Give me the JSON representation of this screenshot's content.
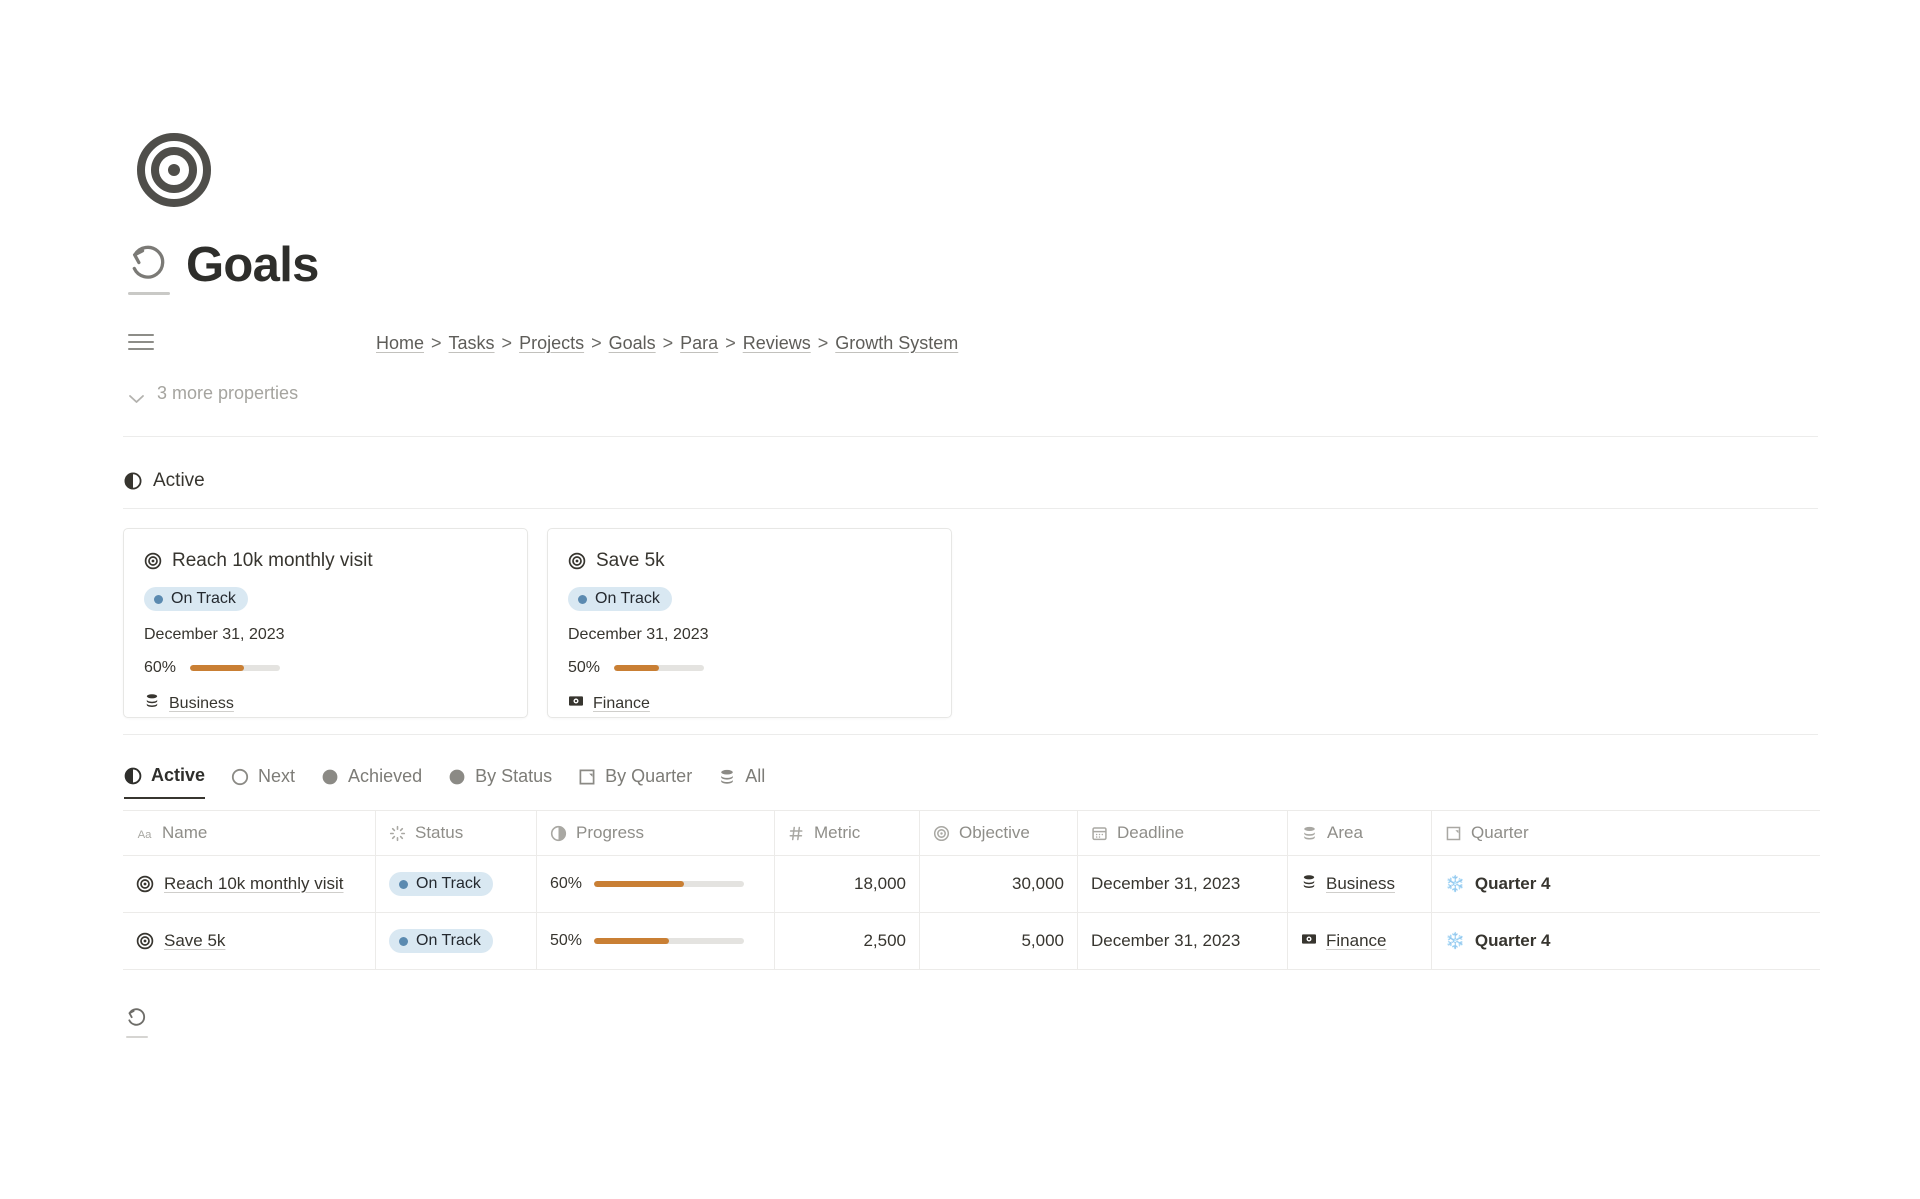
{
  "header": {
    "page_icon": "target-bullseye-icon",
    "title_icon": "history-rotate-ccw-icon",
    "title": "Goals"
  },
  "breadcrumb": {
    "menu_icon": "hamburger-menu-icon",
    "separator": ">",
    "items": [
      {
        "label": "Home"
      },
      {
        "label": "Tasks"
      },
      {
        "label": "Projects"
      },
      {
        "label": "Goals"
      },
      {
        "label": "Para"
      },
      {
        "label": "Reviews"
      },
      {
        "label": "Growth System"
      }
    ]
  },
  "properties_toggle": {
    "icon": "chevron-down-icon",
    "label": "3 more properties"
  },
  "section": {
    "icon": "half-circle-icon",
    "label": "Active"
  },
  "cards": [
    {
      "icon": "target-icon",
      "title": "Reach 10k monthly visit",
      "status": "On Track",
      "status_color": "#d9e8f2",
      "status_dot_color": "#5b8ab0",
      "date": "December 31, 2023",
      "progress_label": "60%",
      "progress_value": 60,
      "area_icon": "database-layers-icon",
      "area": "Business"
    },
    {
      "icon": "target-icon",
      "title": "Save 5k",
      "status": "On Track",
      "status_color": "#d9e8f2",
      "status_dot_color": "#5b8ab0",
      "date": "December 31, 2023",
      "progress_label": "50%",
      "progress_value": 50,
      "area_icon": "banknote-money-icon",
      "area": "Finance"
    }
  ],
  "view_tabs": [
    {
      "label": "Active",
      "icon": "half-circle-icon",
      "selected": true
    },
    {
      "label": "Next",
      "icon": "circle-outline-icon",
      "selected": false
    },
    {
      "label": "Achieved",
      "icon": "circle-filled-icon",
      "selected": false
    },
    {
      "label": "By Status",
      "icon": "circle-filled-icon",
      "selected": false
    },
    {
      "label": "By Quarter",
      "icon": "board-page-icon",
      "selected": false
    },
    {
      "label": "All",
      "icon": "database-layers-icon",
      "selected": false
    }
  ],
  "table": {
    "columns": [
      {
        "label": "Name",
        "icon": "text-aa-icon"
      },
      {
        "label": "Status",
        "icon": "spinner-status-icon"
      },
      {
        "label": "Progress",
        "icon": "half-circle-icon"
      },
      {
        "label": "Metric",
        "icon": "number-hash-icon"
      },
      {
        "label": "Objective",
        "icon": "target-icon"
      },
      {
        "label": "Deadline",
        "icon": "calendar-icon"
      },
      {
        "label": "Area",
        "icon": "database-layers-icon"
      },
      {
        "label": "Quarter",
        "icon": "board-page-icon"
      }
    ],
    "rows": [
      {
        "name_icon": "target-icon",
        "name": "Reach 10k monthly visit",
        "status": "On Track",
        "progress_label": "60%",
        "progress_value": 60,
        "metric": "18,000",
        "objective": "30,000",
        "deadline": "December 31, 2023",
        "area_icon": "database-layers-icon",
        "area": "Business",
        "quarter_emoji": "❄️",
        "quarter": "Quarter 4"
      },
      {
        "name_icon": "target-icon",
        "name": "Save 5k",
        "status": "On Track",
        "progress_label": "50%",
        "progress_value": 50,
        "metric": "2,500",
        "objective": "5,000",
        "deadline": "December 31, 2023",
        "area_icon": "banknote-money-icon",
        "area": "Finance",
        "quarter_emoji": "❄️",
        "quarter": "Quarter 4"
      }
    ]
  },
  "footer": {
    "icon": "history-rotate-ccw-icon"
  },
  "colors": {
    "progress_fill": "#c97f34",
    "progress_track": "#e4e3e0",
    "status_badge_bg": "#d9e8f2",
    "status_dot": "#5b8ab0",
    "text_primary": "#37352f",
    "text_muted": "#8f8e89"
  }
}
